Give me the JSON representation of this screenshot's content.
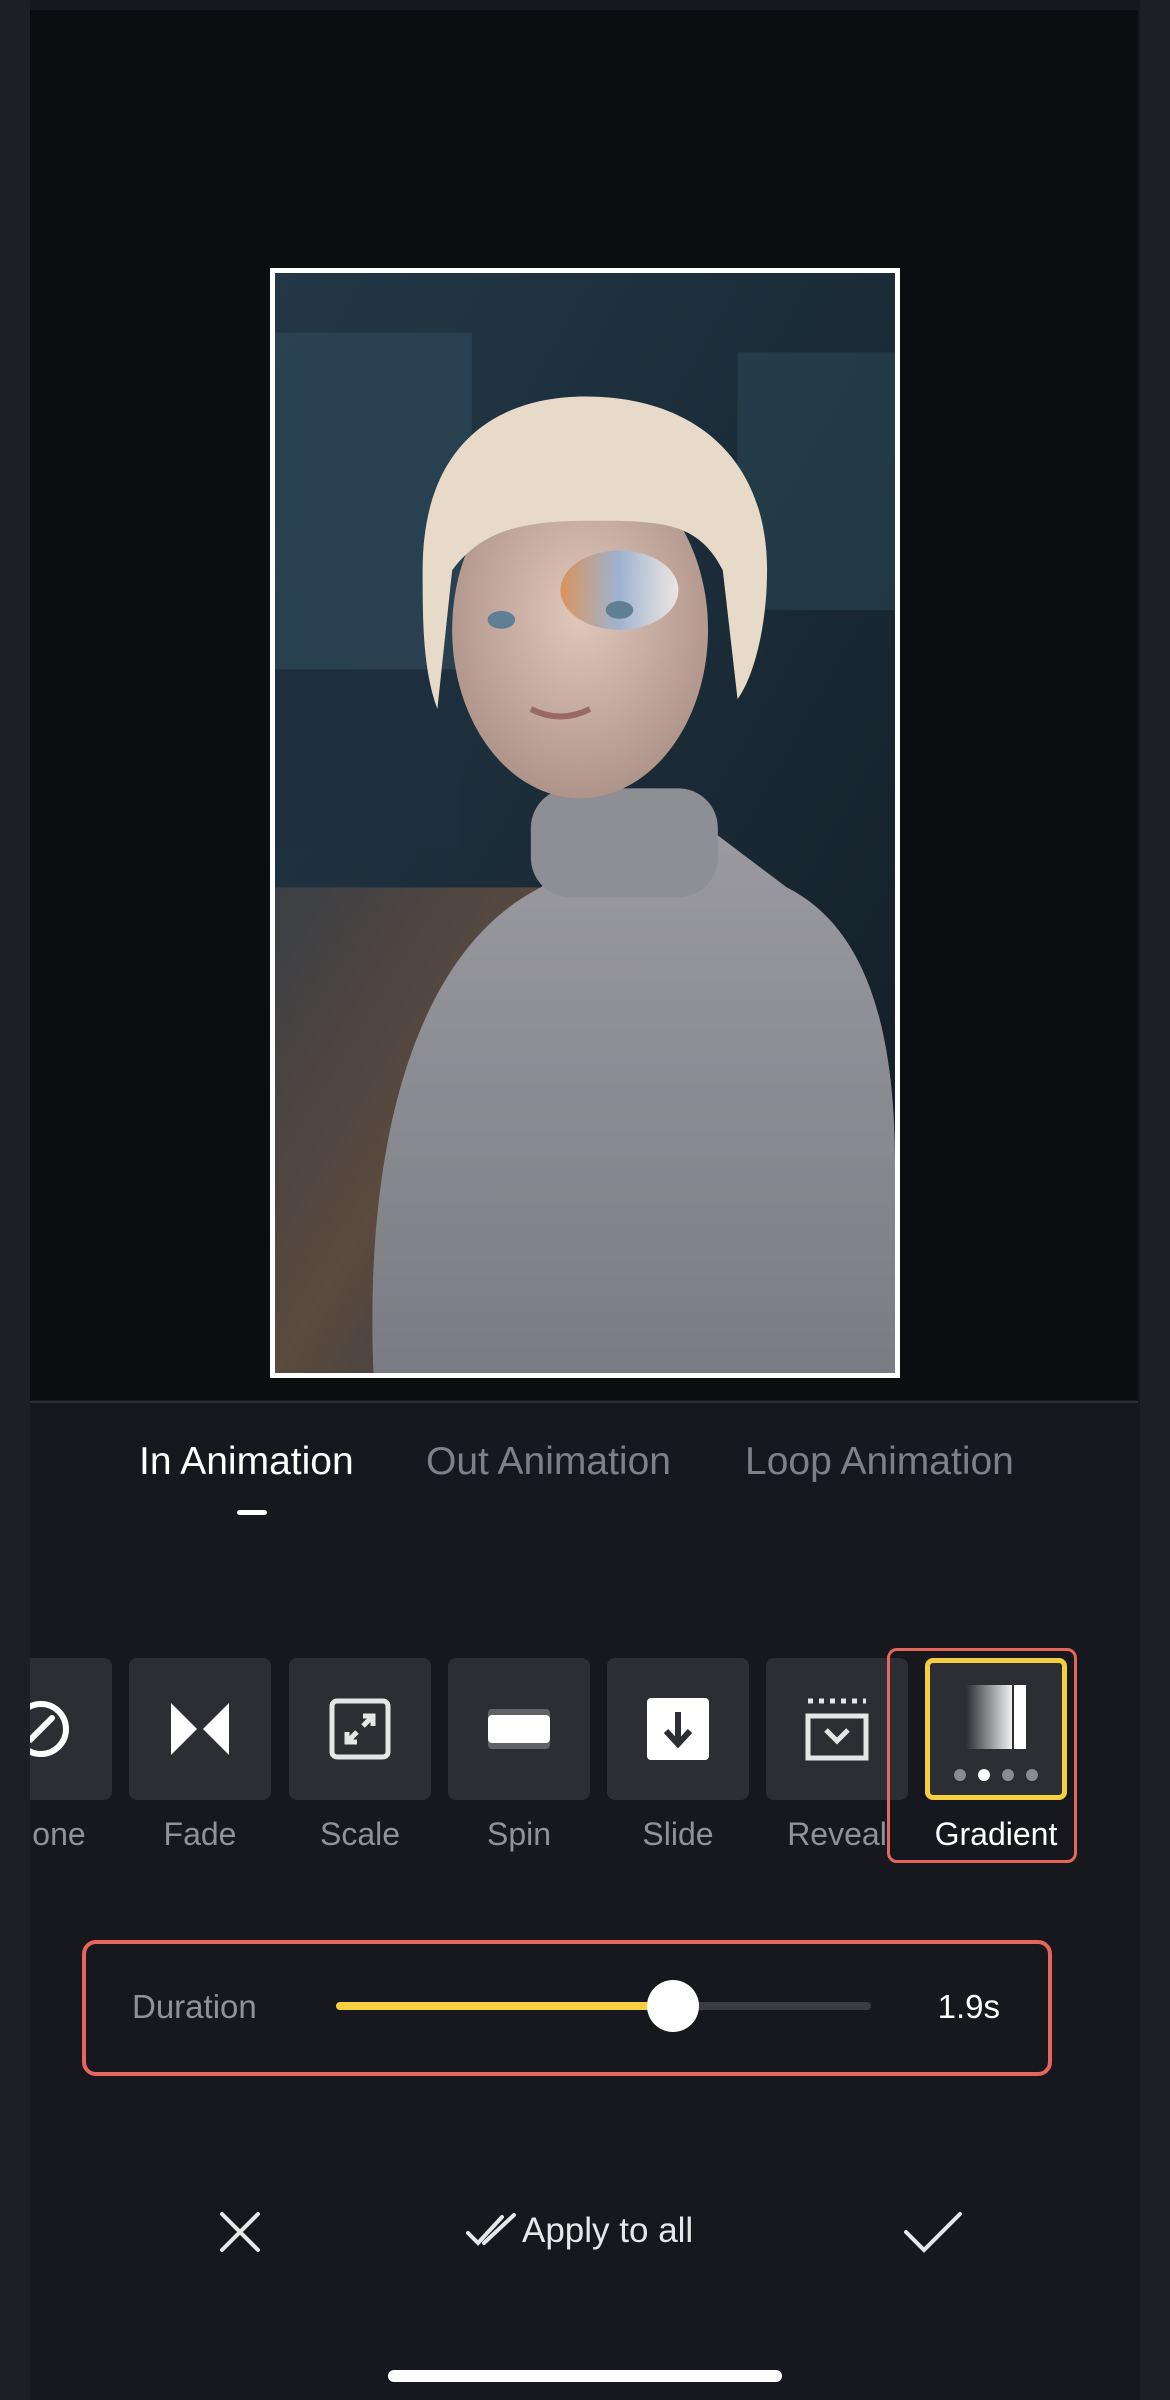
{
  "tabs": [
    {
      "label": "In Animation",
      "active": true
    },
    {
      "label": "Out Animation",
      "active": false
    },
    {
      "label": "Loop Animation",
      "active": false
    }
  ],
  "animations": [
    {
      "label": "None",
      "shown_label": "one",
      "icon": "none-circle-slash-icon"
    },
    {
      "label": "Fade",
      "icon": "fade-bowtie-icon"
    },
    {
      "label": "Scale",
      "icon": "scale-corners-icon"
    },
    {
      "label": "Spin",
      "icon": "spin-blur-icon"
    },
    {
      "label": "Slide",
      "icon": "slide-down-arrow-icon"
    },
    {
      "label": "Reveal",
      "icon": "reveal-icon"
    },
    {
      "label": "Gradient",
      "icon": "gradient-icon",
      "selected": true,
      "variant_dots": 4,
      "active_dot": 2
    }
  ],
  "duration": {
    "label": "Duration",
    "value": "1.9s",
    "fraction": 0.63,
    "accent": "#f5cf3f"
  },
  "bottom": {
    "apply_label": "Apply to all"
  },
  "colors": {
    "background": "#16181d",
    "highlight": "#e7665c",
    "selection": "#f5cf3f"
  }
}
